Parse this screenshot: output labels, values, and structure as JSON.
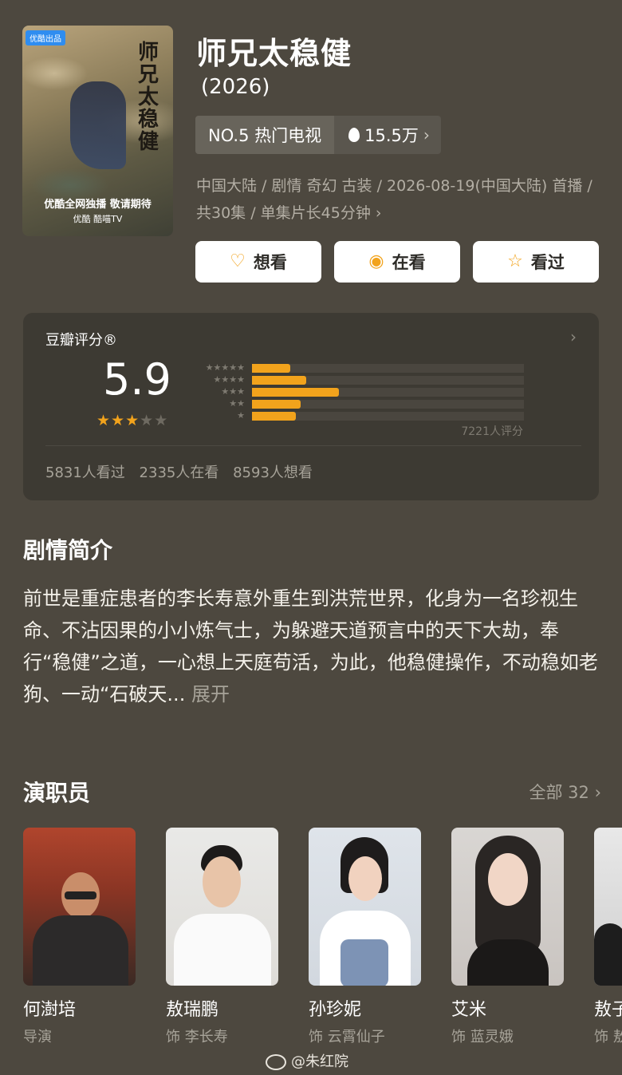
{
  "poster": {
    "badge": "优酷出品",
    "title_art": "师兄太稳健",
    "exclusive": "优酷全网独播 敬请期待",
    "platforms": "优酷 酷喵TV"
  },
  "show": {
    "title": "师兄太稳健",
    "year": "(2026)",
    "rank": "NO.5 热门电视",
    "heat": "15.5万",
    "meta": "中国大陆 / 剧情 奇幻 古装 / 2026-08-19(中国大陆) 首播 / 共30集 / 单集片长45分钟"
  },
  "actions": [
    {
      "label": "想看",
      "icon": "heart-plus-icon"
    },
    {
      "label": "在看",
      "icon": "target-circle-icon"
    },
    {
      "label": "看过",
      "icon": "star-outline-icon"
    }
  ],
  "rating": {
    "title": "豆瓣评分®",
    "score": "5.9",
    "stars_value": 3,
    "distribution": [
      {
        "stars": "★★★★★",
        "fraction": 0.14
      },
      {
        "stars": "★★★★",
        "fraction": 0.2
      },
      {
        "stars": "★★★",
        "fraction": 0.32
      },
      {
        "stars": "★★",
        "fraction": 0.18
      },
      {
        "stars": "★",
        "fraction": 0.16
      }
    ],
    "raters": "7221人评分",
    "watched": "5831人看过",
    "watching": "2335人在看",
    "want": "8593人想看"
  },
  "synopsis": {
    "heading": "剧情简介",
    "text": "前世是重症患者的李长寿意外重生到洪荒世界，化身为一名珍视生命、不沾因果的小小炼气士，为躲避天道预言中的天下大劫，奉行“稳健”之道，一心想上天庭苟活，为此，他稳健操作，不动稳如老狗、一动“石破天...",
    "expand": "展开"
  },
  "cast": {
    "heading": "演职员",
    "all_label": "全部 32",
    "members": [
      {
        "name": "何澍培",
        "role": "导演"
      },
      {
        "name": "敖瑞鹏",
        "role": "饰 李长寿"
      },
      {
        "name": "孙珍妮",
        "role": "饰 云霄仙子"
      },
      {
        "name": "艾米",
        "role": "饰 蓝灵娥"
      },
      {
        "name": "敖子",
        "role": "饰 敖"
      }
    ]
  },
  "watermark": "@朱红院"
}
